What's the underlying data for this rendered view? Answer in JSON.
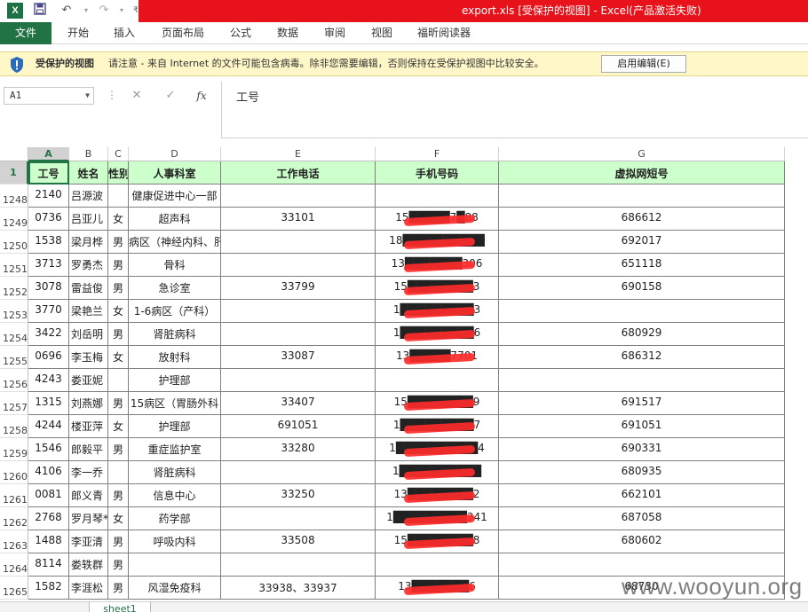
{
  "window": {
    "title": "export.xls  [受保护的视图] -  Excel(产品激活失败)",
    "app_icon": "X",
    "colors": {
      "title_band": "#e8121b",
      "excel_green": "#217346",
      "header_fill": "#ccffcc",
      "redaction": "#ff2b2b"
    }
  },
  "ribbon": {
    "file_tab": "文件",
    "tabs": [
      "开始",
      "插入",
      "页面布局",
      "公式",
      "数据",
      "审阅",
      "视图",
      "福昕阅读器"
    ]
  },
  "protected_view": {
    "title": "受保护的视图",
    "message": "请注意 - 来自 Internet 的文件可能包含病毒。除非您需要编辑，否则保持在受保护视图中比较安全。",
    "button": "启用编辑(E)"
  },
  "formula_bar": {
    "name_box": "A1",
    "cancel_glyph": "✕",
    "enter_glyph": "✓",
    "fx_glyph": "fx",
    "content": "工号"
  },
  "sheet": {
    "columns": [
      "A",
      "B",
      "C",
      "D",
      "E",
      "F",
      "G"
    ],
    "header_row_number": "1",
    "headers": [
      "工号",
      "姓名",
      "性别",
      "人事科室",
      "工作电话",
      "手机号码",
      "虚拟网短号"
    ],
    "rows": [
      {
        "n": "1248",
        "id": "2140",
        "name": "吕源波",
        "sex": "",
        "dept": "健康促进中心一部",
        "tel": "",
        "mobile": "",
        "short": ""
      },
      {
        "n": "1249",
        "id": "0736",
        "name": "吕亚儿",
        "sex": "女",
        "dept": "超声科",
        "tel": "33101",
        "mobile": "15█████7█88",
        "short": "686612"
      },
      {
        "n": "1250",
        "id": "1538",
        "name": "梁月桦",
        "sex": "男",
        "dept": "病区（神经内科、肝",
        "tel": "",
        "mobile": "18██████████",
        "short": "692017"
      },
      {
        "n": "1251",
        "id": "3713",
        "name": "罗勇杰",
        "sex": "男",
        "dept": "骨科",
        "tel": "",
        "mobile": "13███████306",
        "short": "651118"
      },
      {
        "n": "1252",
        "id": "3078",
        "name": "雷益俊",
        "sex": "男",
        "dept": "急诊室",
        "tel": "33799",
        "mobile": "15████████3",
        "short": "690158"
      },
      {
        "n": "1253",
        "id": "3770",
        "name": "梁艳兰",
        "sex": "女",
        "dept": "1-6病区（产科）",
        "tel": "",
        "mobile": "1█████████3",
        "short": ""
      },
      {
        "n": "1254",
        "id": "3422",
        "name": "刘岳明",
        "sex": "男",
        "dept": "肾脏病科",
        "tel": "",
        "mobile": "1█████████6",
        "short": "680929"
      },
      {
        "n": "1255",
        "id": "0696",
        "name": "李玉梅",
        "sex": "女",
        "dept": "放射科",
        "tel": "33087",
        "mobile": "13█████7701",
        "short": "686312"
      },
      {
        "n": "1256",
        "id": "4243",
        "name": "娄亚妮",
        "sex": "",
        "dept": "护理部",
        "tel": "",
        "mobile": "",
        "short": ""
      },
      {
        "n": "1257",
        "id": "1315",
        "name": "刘燕娜",
        "sex": "男",
        "dept": "15病区（胃肠外科",
        "tel": "33407",
        "mobile": "15████████9",
        "short": "691517"
      },
      {
        "n": "1258",
        "id": "4244",
        "name": "楼亚萍",
        "sex": "女",
        "dept": "护理部",
        "tel": "691051",
        "mobile": "1█████████7",
        "short": "691051"
      },
      {
        "n": "1259",
        "id": "1546",
        "name": "郎毅平",
        "sex": "男",
        "dept": "重症监护室",
        "tel": "33280",
        "mobile": "1██████████4",
        "short": "690331"
      },
      {
        "n": "1260",
        "id": "4106",
        "name": "李一乔",
        "sex": "",
        "dept": "肾脏病科",
        "tel": "",
        "mobile": "1██████████",
        "short": "680935"
      },
      {
        "n": "1261",
        "id": "0081",
        "name": "郎义青",
        "sex": "男",
        "dept": "信息中心",
        "tel": "33250",
        "mobile": "13████████2",
        "short": "662101"
      },
      {
        "n": "1262",
        "id": "2768",
        "name": "罗月琴*",
        "sex": "女",
        "dept": "药学部",
        "tel": "",
        "mobile": "1█████████341",
        "short": "687058"
      },
      {
        "n": "1263",
        "id": "1488",
        "name": "李亚清",
        "sex": "男",
        "dept": "呼吸内科",
        "tel": "33508",
        "mobile": "15████████8",
        "short": "680602"
      },
      {
        "n": "1264",
        "id": "8114",
        "name": "娄轶群",
        "sex": "男",
        "dept": "",
        "tel": "",
        "mobile": "",
        "short": ""
      },
      {
        "n": "1265",
        "id": "1582",
        "name": "李涯松",
        "sex": "男",
        "dept": "风湿免疫科",
        "tel": "33938、33937",
        "mobile": "13███████6",
        "short": "68730"
      }
    ],
    "sheet_tab": "sheet1"
  },
  "watermark": "www.wooyun.org"
}
